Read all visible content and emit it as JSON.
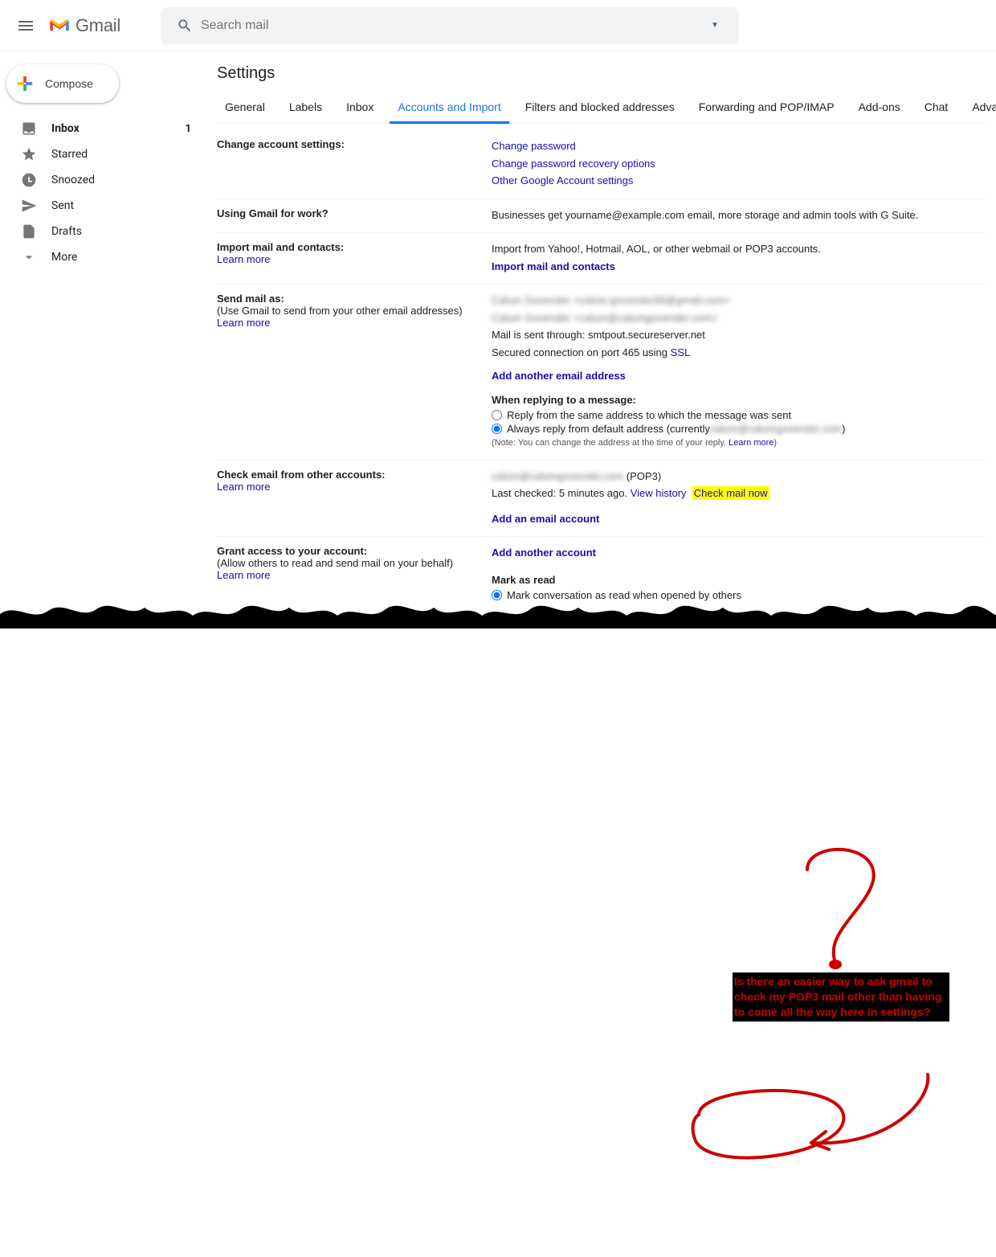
{
  "header": {
    "app_name": "Gmail",
    "search_placeholder": "Search mail"
  },
  "sidebar": {
    "compose_label": "Compose",
    "items": [
      {
        "label": "Inbox",
        "count": "1"
      },
      {
        "label": "Starred"
      },
      {
        "label": "Snoozed"
      },
      {
        "label": "Sent"
      },
      {
        "label": "Drafts"
      },
      {
        "label": "More"
      }
    ]
  },
  "settings": {
    "title": "Settings",
    "tabs": [
      "General",
      "Labels",
      "Inbox",
      "Accounts and Import",
      "Filters and blocked addresses",
      "Forwarding and POP/IMAP",
      "Add-ons",
      "Chat",
      "Advanced"
    ],
    "active_tab_index": 3,
    "sections": {
      "change_account": {
        "heading": "Change account settings:",
        "links": [
          "Change password",
          "Change password recovery options",
          "Other Google Account settings"
        ]
      },
      "using_work": {
        "heading": "Using Gmail for work?",
        "desc": "Businesses get yourname@example.com email, more storage and admin tools with G Suite."
      },
      "import": {
        "heading": "Import mail and contacts:",
        "learn_more": "Learn more",
        "desc": "Import from Yahoo!, Hotmail, AOL, or other webmail or POP3 accounts.",
        "action": "Import mail and contacts"
      },
      "send_as": {
        "heading": "Send mail as:",
        "sub": "(Use Gmail to send from your other email addresses)",
        "learn_more": "Learn more",
        "blur1": "Calum Govender <calum.govender99@gmail.com>",
        "blur2": "Calum Govender <calum@calumgovender.com>",
        "mail_through": "Mail is sent through: smtpout.secureserver.net",
        "secured": "Secured connection on port 465 using ",
        "ssl": "SSL",
        "add_address": "Add another email address",
        "reply_heading": "When replying to a message:",
        "reply_opt1": "Reply from the same address to which the message was sent",
        "reply_opt2_pre": "Always reply from default address (currently ",
        "reply_opt2_blur": "calum@calumgovender.com",
        "reply_opt2_post": ")",
        "note": "(Note: You can change the address at the time of your reply. ",
        "note_link": "Learn more",
        "note_end": ")"
      },
      "check_other": {
        "heading": "Check email from other accounts:",
        "learn_more": "Learn more",
        "blur_acct": "calum@calumgovender.com",
        "pop3": " (POP3)",
        "last_checked": "Last checked: 5 minutes ago. ",
        "view_history": "View history",
        "check_now": "Check mail now",
        "add_account": "Add an email account"
      },
      "grant_access": {
        "heading": "Grant access to your account:",
        "sub": "(Allow others to read and send mail on your behalf)",
        "learn_more": "Learn more",
        "add_another": "Add another account",
        "mark_read_heading": "Mark as read",
        "mark_read_opt": "Mark conversation as read when opened by others"
      }
    }
  },
  "annotation": "Is there an easier way to ask gmail to check my POP3 mail other than having to come all the way here in settings?"
}
